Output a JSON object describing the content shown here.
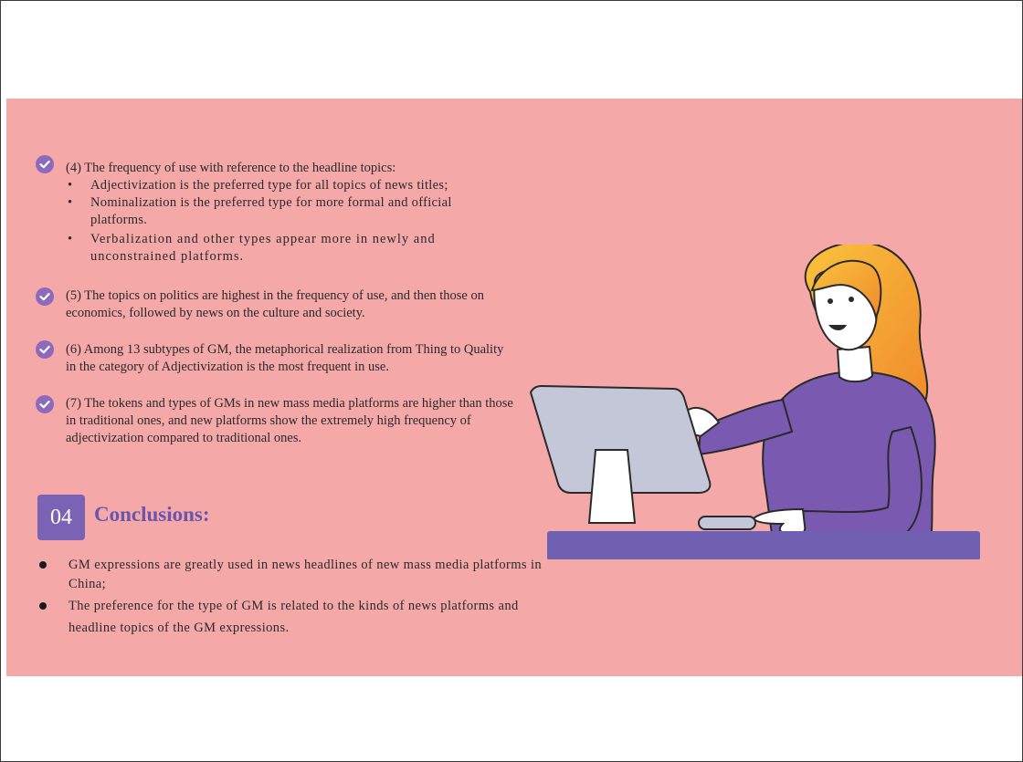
{
  "findings": {
    "item4": {
      "heading": "(4) The frequency of use with reference to the headline topics:",
      "bullets": [
        "Adjectivization is the preferred type for all topics of news titles;",
        "Nominalization is the preferred type for more formal and official platforms.",
        "Verbalization and other types appear more in newly and unconstrained platforms."
      ]
    },
    "item5": "(5) The topics on politics are highest in the frequency of use, and then those on economics, followed by news on the culture and society.",
    "item6": "(6) Among 13 subtypes of GM, the metaphorical realization from Thing to Quality in the category of Adjectivization is the most frequent in use.",
    "item7": "(7) The tokens and types of GMs in new mass media platforms are higher than those in traditional ones, and new platforms show the extremely high frequency of adjectivization compared to traditional ones."
  },
  "conclusions": {
    "number": "04",
    "title": "Conclusions:",
    "points": [
      "GM expressions are greatly used in news headlines of new mass media platforms in China;",
      "The preference for the type of GM is related to the kinds of news platforms and headline topics of the GM expressions."
    ]
  },
  "icons": {
    "check": "check-circle-icon",
    "illustration": "woman-at-computer-illustration"
  },
  "colors": {
    "panel_background": "#f5a8a8",
    "accent_purple": "#7a62b4",
    "check_purple": "#8c6bbd"
  }
}
